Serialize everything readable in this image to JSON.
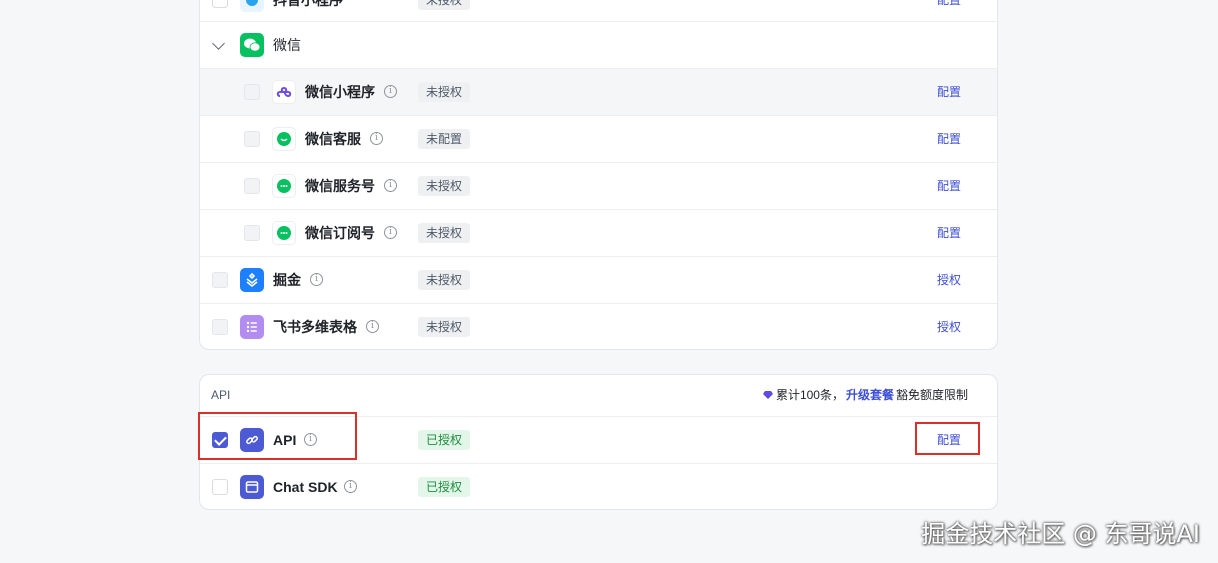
{
  "top_partial_row": {
    "name": "抖音小程序",
    "status": "未授权",
    "action": "配置"
  },
  "wechat_group": {
    "label": "微信"
  },
  "wechat_items": [
    {
      "name": "微信小程序",
      "status": "未授权",
      "action": "配置"
    },
    {
      "name": "微信客服",
      "status": "未配置",
      "action": "配置"
    },
    {
      "name": "微信服务号",
      "status": "未授权",
      "action": "配置"
    },
    {
      "name": "微信订阅号",
      "status": "未授权",
      "action": "配置"
    }
  ],
  "other_items": [
    {
      "name": "掘金",
      "status": "未授权",
      "action": "授权"
    },
    {
      "name": "飞书多维表格",
      "status": "未授权",
      "action": "授权"
    }
  ],
  "api_section": {
    "title": "API",
    "quota_prefix": "累计100条，",
    "upgrade_link": "升级套餐",
    "quota_suffix": "豁免额度限制",
    "items": [
      {
        "name": "API",
        "status": "已授权",
        "action": "配置",
        "checked": true
      },
      {
        "name": "Chat SDK",
        "status": "已授权",
        "action": "",
        "checked": false
      }
    ]
  },
  "info_glyph": "i",
  "watermark": "掘金技术社区 @ 东哥说AI",
  "colors": {
    "accent": "#3d4fd6",
    "wechat_green": "#07c160",
    "highlight_red": "#d9302c",
    "authorized_bg": "#e4f5e9"
  }
}
